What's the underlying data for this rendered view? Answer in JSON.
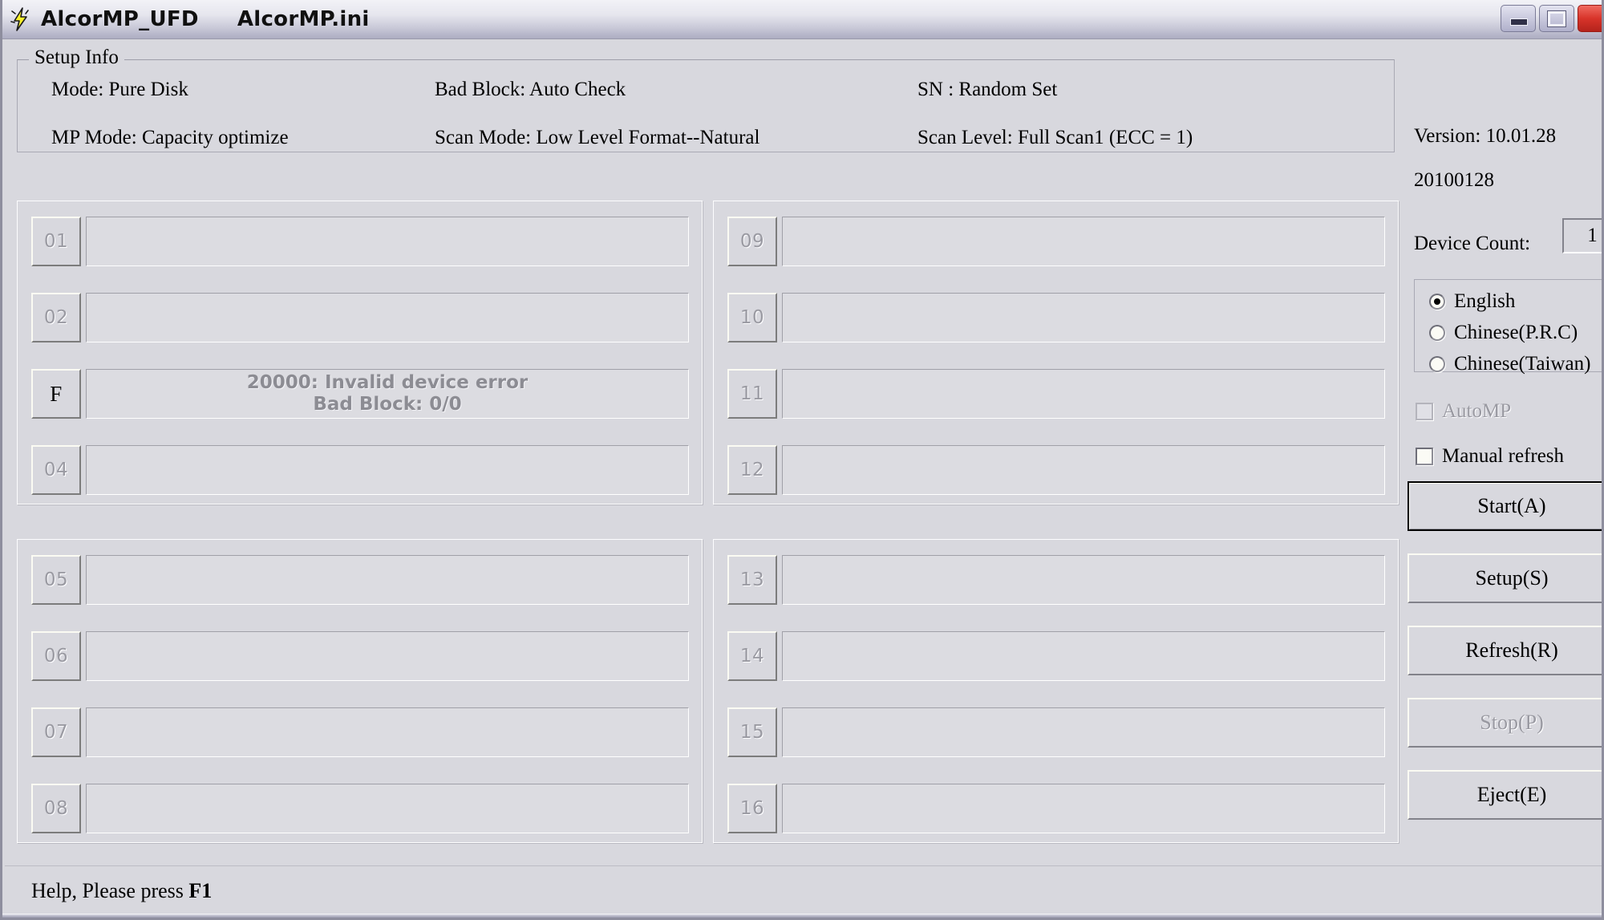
{
  "window": {
    "app_title": "AlcorMP_UFD",
    "ini_file": "AlcorMP.ini",
    "icon": "lightning-bolt-icon",
    "controls": {
      "minimize": "minimize-button",
      "maximize": "maximize-button",
      "close": "close-button"
    }
  },
  "setup_info": {
    "legend": "Setup Info",
    "mode": "Mode: Pure Disk",
    "mp_mode": "MP Mode: Capacity optimize",
    "bad_block": "Bad Block: Auto Check",
    "scan_mode": "Scan Mode: Low Level Format--Natural",
    "sn": "SN : Random Set",
    "scan_level": "Scan Level: Full Scan1 (ECC = 1)"
  },
  "slots": {
    "panel_a": [
      {
        "label": "01",
        "state": "disabled",
        "message": ""
      },
      {
        "label": "02",
        "state": "disabled",
        "message": ""
      },
      {
        "label": "F",
        "state": "active",
        "message_line1": "20000: Invalid device error",
        "message_line2": "Bad Block: 0/0"
      },
      {
        "label": "04",
        "state": "disabled",
        "message": ""
      }
    ],
    "panel_b": [
      {
        "label": "09",
        "state": "disabled",
        "message": ""
      },
      {
        "label": "10",
        "state": "disabled",
        "message": ""
      },
      {
        "label": "11",
        "state": "disabled",
        "message": ""
      },
      {
        "label": "12",
        "state": "disabled",
        "message": ""
      }
    ],
    "panel_c": [
      {
        "label": "05",
        "state": "disabled",
        "message": ""
      },
      {
        "label": "06",
        "state": "disabled",
        "message": ""
      },
      {
        "label": "07",
        "state": "disabled",
        "message": ""
      },
      {
        "label": "08",
        "state": "disabled",
        "message": ""
      }
    ],
    "panel_d": [
      {
        "label": "13",
        "state": "disabled",
        "message": ""
      },
      {
        "label": "14",
        "state": "disabled",
        "message": ""
      },
      {
        "label": "15",
        "state": "disabled",
        "message": ""
      },
      {
        "label": "16",
        "state": "disabled",
        "message": ""
      }
    ]
  },
  "sidebar": {
    "version": "Version: 10.01.28",
    "build_date": "20100128",
    "device_count_label": "Device Count:",
    "device_count_value": "1",
    "languages": [
      {
        "label": "English",
        "selected": true
      },
      {
        "label": "Chinese(P.R.C)",
        "selected": false
      },
      {
        "label": "Chinese(Taiwan)",
        "selected": false
      }
    ],
    "checkboxes": [
      {
        "label": "AutoMP",
        "checked": false,
        "enabled": false
      },
      {
        "label": "Manual refresh",
        "checked": false,
        "enabled": true
      }
    ],
    "buttons": [
      {
        "label": "Start(A)",
        "state": "default"
      },
      {
        "label": "Setup(S)",
        "state": "enabled"
      },
      {
        "label": "Refresh(R)",
        "state": "enabled"
      },
      {
        "label": "Stop(P)",
        "state": "disabled"
      },
      {
        "label": "Eject(E)",
        "state": "enabled"
      }
    ]
  },
  "statusbar": {
    "help_text": "Help, Please press ",
    "help_key": "F1"
  },
  "colors": {
    "face": "#d8d8de",
    "title_gradient_start": "#f2f2f7",
    "title_gradient_end": "#adadc2",
    "close_red": "#d8342a",
    "disabled_text": "#9a9aa2",
    "message_text": "#8c8c93"
  }
}
